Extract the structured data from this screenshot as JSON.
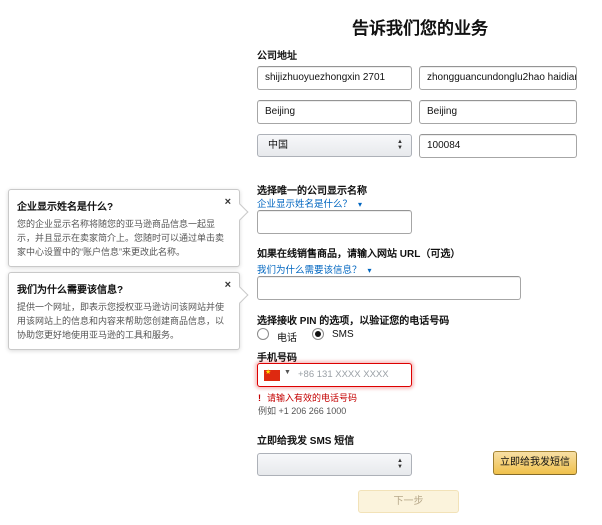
{
  "page": {
    "title": "告诉我们您的业务"
  },
  "address": {
    "label": "公司地址",
    "line1": "shijizhuoyuezhongxin 2701",
    "line2": "zhongguancundonglu2hao haidian",
    "city": "Beijing",
    "state": "Beijing",
    "country": "中国",
    "postal_code": "100084"
  },
  "display_name": {
    "label": "选择唯一的公司显示名称",
    "help_link": "企业显示姓名是什么？",
    "value": ""
  },
  "website": {
    "label": "如果在线销售商品，请输入网站 URL（可选）",
    "help_link": "我们为什么需要该信息？",
    "value": ""
  },
  "popovers": [
    {
      "title": "企业显示姓名是什么?",
      "text": "您的企业显示名称将随您的亚马逊商品信息一起显示，并且显示在卖家简介上。您随时可以通过单击卖家中心设置中的“账户信息”来更改此名称。",
      "close": "×"
    },
    {
      "title": "我们为什么需要该信息?",
      "text": "提供一个网址，即表示您授权亚马逊访问该网站并使用该网站上的信息和内容来帮助您创建商品信息，以协助您更好地使用亚马逊的工具和服务。",
      "close": "×"
    }
  ],
  "pin": {
    "label": "选择接收 PIN 的选项，以验证您的电话号码",
    "options": [
      "电话",
      "SMS"
    ],
    "selected": "SMS"
  },
  "phone": {
    "label": "手机号码",
    "country_flag": "china-flag-icon",
    "placeholder": "+86 131  XXXX XXXX",
    "error": "请输入有效的电话号码",
    "error_mark": "!",
    "example": "例如 +1 206 266 1000"
  },
  "sms": {
    "label": "立即给我发 SMS 短信",
    "select_value": "",
    "send_button": "立即给我发短信"
  },
  "next_button": "下一步",
  "colors": {
    "link": "#0066c0",
    "error": "#c40000",
    "primary_button": "#f0c14b"
  }
}
